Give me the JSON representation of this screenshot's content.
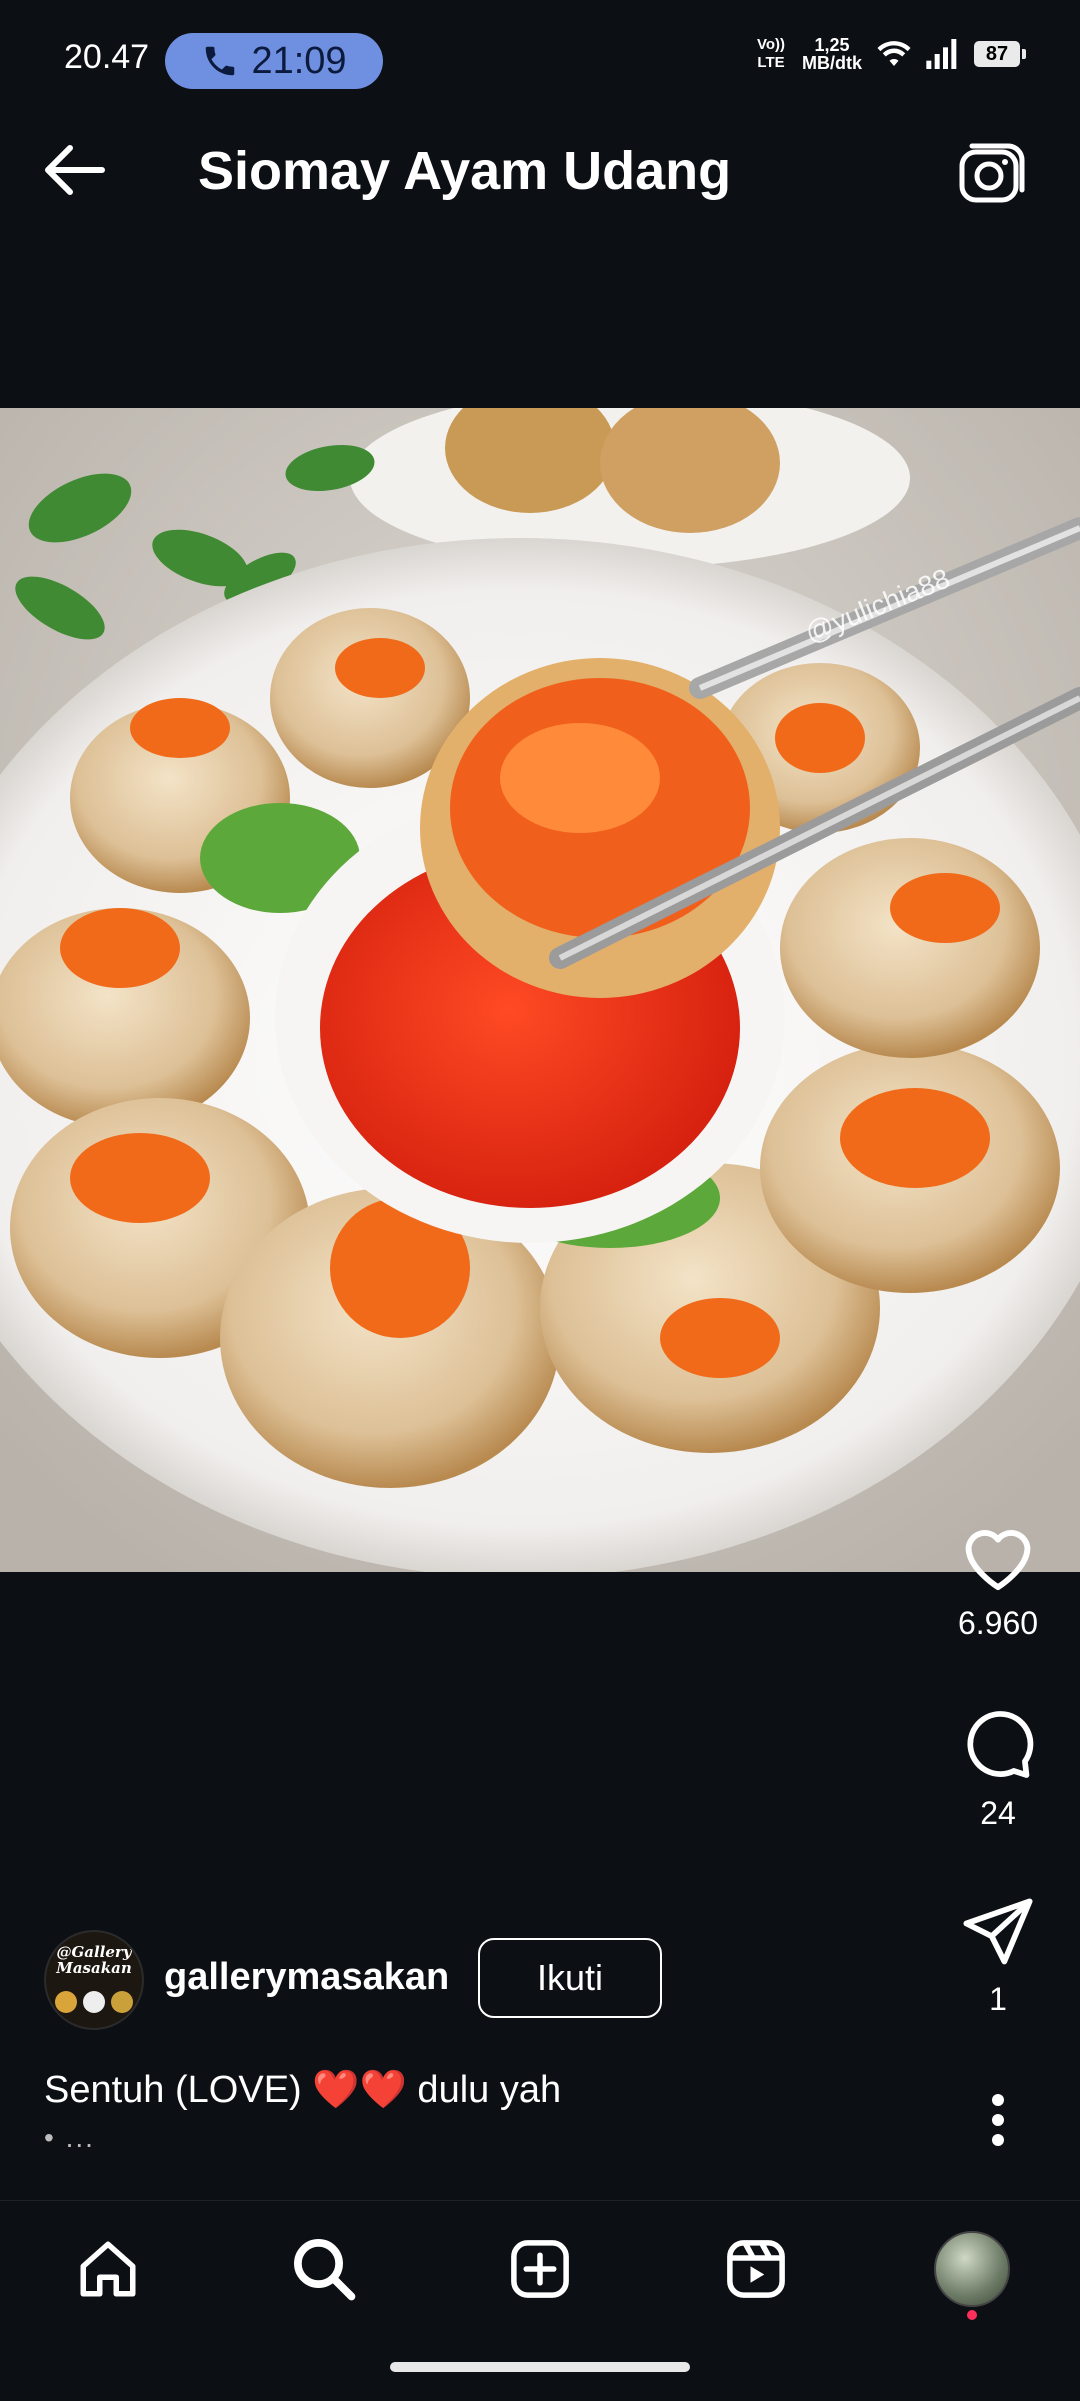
{
  "status_bar": {
    "time": "20.47",
    "call_timer": "21:09",
    "network_type": "Vo)) LTE",
    "speed_value": "1,25",
    "speed_unit": "MB/dtk",
    "battery": "87"
  },
  "header": {
    "title": "Siomay Ayam Udang"
  },
  "post": {
    "watermark": "@yulichia88",
    "likes": "6.960",
    "comments": "24",
    "shares": "1",
    "username": "gallerymasakan",
    "follow_label": "Ikuti",
    "caption": "Sentuh (LOVE) ❤️❤️ dulu yah",
    "caption_more": "• ..."
  },
  "avatar_text": {
    "line1": "@Gallery",
    "line2": "Masakan"
  },
  "colors": {
    "background": "#0c0f14",
    "call_pill": "#6f8fe0",
    "notification_dot": "#ff2f5b"
  }
}
